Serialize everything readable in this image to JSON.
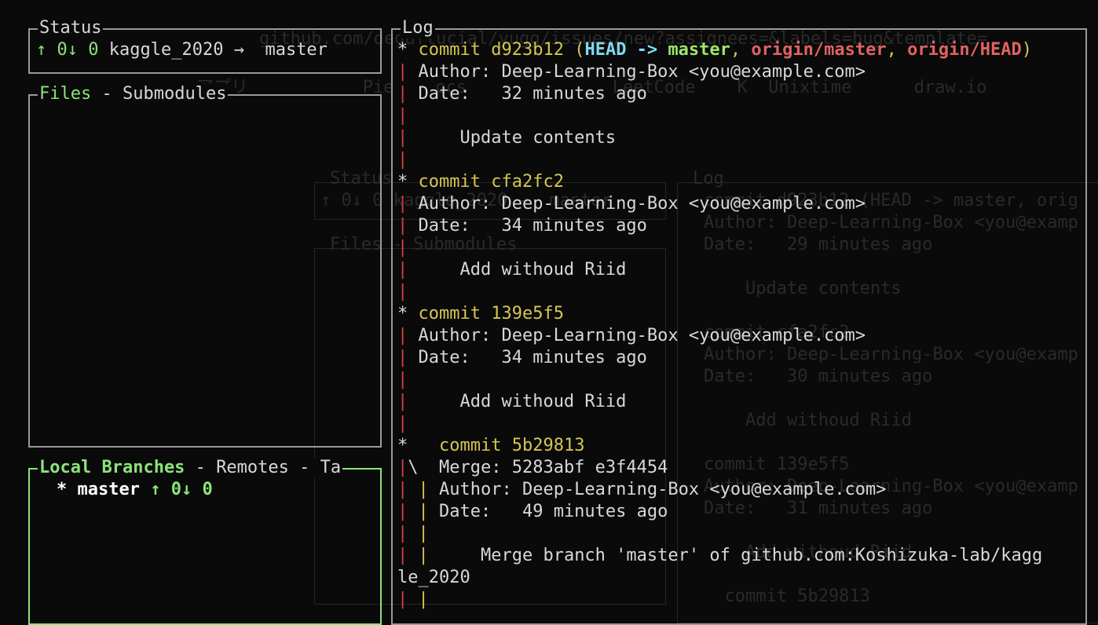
{
  "status": {
    "title": "Status",
    "ahead": "↑ 0",
    "behind": "↓ 0",
    "repo": "kaggle_2020",
    "arrow": "→",
    "branch": "master"
  },
  "files": {
    "title_active": "Files",
    "separator": " - ",
    "title_other": "Submodules"
  },
  "branches": {
    "title_active": "Local Branches",
    "sep1": " - ",
    "remotes": "Remotes",
    "sep2": " - ",
    "tags": "Ta",
    "items": [
      {
        "marker": "*",
        "name": "master",
        "counts": "↑ 0↓ 0"
      }
    ]
  },
  "log": {
    "title": "Log",
    "commits": [
      {
        "word": "commit",
        "hash": "d923b12",
        "open": " (",
        "head": "HEAD -> ",
        "local": "master",
        "c1": ", ",
        "remote1": "origin/master",
        "c2": ", ",
        "remote2": "origin/HEAD",
        "close": ")",
        "author": "Author: Deep-Learning-Box <you@example.com>",
        "date": "Date:   32 minutes ago",
        "message": "Update contents"
      },
      {
        "word": "commit",
        "hash": "cfa2fc2",
        "author": "Author: Deep-Learning-Box <you@example.com>",
        "date": "Date:   34 minutes ago",
        "message": "Add withoud Riid"
      },
      {
        "word": "commit",
        "hash": "139e5f5",
        "author": "Author: Deep-Learning-Box <you@example.com>",
        "date": "Date:   34 minutes ago",
        "message": "Add withoud Riid"
      },
      {
        "word": "commit",
        "hash": "5b29813",
        "merge": "Merge: 5283abf e3f4454",
        "author": "Author: Deep-Learning-Box <you@example.com>",
        "date": "Date:   49 minutes ago",
        "message": "Merge branch 'master' of github.com:Koshizuka-lab/kagg",
        "message_wrap": "le_2020"
      }
    ]
  },
  "ghost": {
    "url": "github.com/deguflucial/yugg/issues/new?assignees=&labels=bug&template=",
    "bookmarks": "アプリ           Pie    ocs              LeetCode    K  Unixtime      draw.io",
    "status_title": "Status",
    "status_line": "↑ 0↓ 0 kaggle_2020 →  master",
    "files_title": "Files - Submodules",
    "log_title": "Log",
    "log_lines": [
      "commit d923b12 (HEAD -> master, orig",
      "Author: Deep-Learning-Box <you@examp",
      "Date:   29 minutes ago",
      "",
      "    Update contents",
      "",
      "commit cfa2fc2",
      "Author: Deep-Learning-Box <you@examp",
      "Date:   30 minutes ago",
      "",
      "    Add withoud Riid",
      "",
      "commit 139e5f5",
      "Author: Deep-Learning-Box <you@examp",
      "Date:   31 minutes ago",
      "",
      "    Add withoud Riid",
      "",
      "  commit 5b29813"
    ]
  }
}
